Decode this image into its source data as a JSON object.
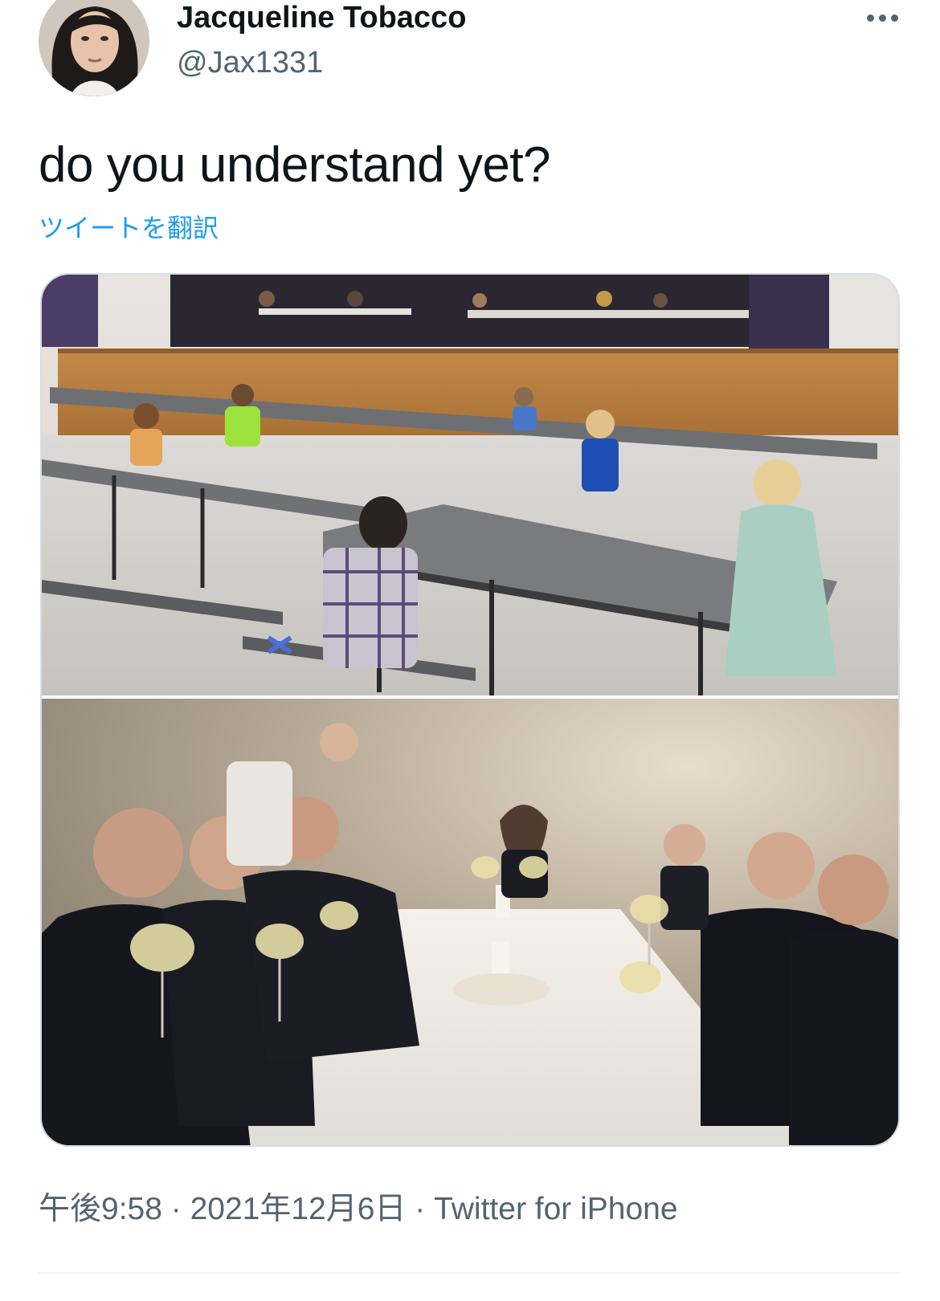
{
  "tweet": {
    "author": {
      "display_name": "Jacqueline Tobacco",
      "handle": "@Jax1331"
    },
    "text": "do you understand yet?",
    "translate_label": "ツイートを翻訳",
    "time": "午後9:58",
    "date": "2021年12月6日",
    "source": "Twitter for iPhone",
    "separator": " · "
  },
  "icons": {
    "more": "more-options-icon"
  },
  "colors": {
    "text_primary": "#0f1419",
    "text_secondary": "#536471",
    "link": "#1d9bf0"
  }
}
